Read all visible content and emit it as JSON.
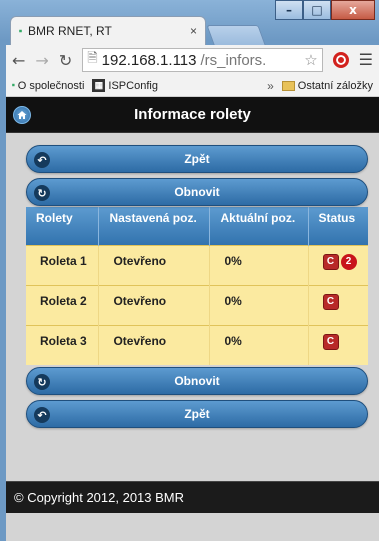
{
  "browser": {
    "tab_title": "BMR RNET, RT",
    "tab_close": "×",
    "url_host": "192.168.1.113",
    "url_path": "/rs_infors.",
    "window_controls": [
      "–",
      "□",
      "x"
    ],
    "bookmarks": [
      {
        "label": "O společnosti",
        "icon": "bmr-logo-icon"
      },
      {
        "label": "ISPConfig",
        "icon": "ispconfig-icon"
      }
    ],
    "bookmarks_more": "»",
    "other_bookmarks": "Ostatní záložky"
  },
  "header": {
    "title": "Informace rolety",
    "home_icon": "home-icon"
  },
  "buttons": {
    "back_label": "Zpět",
    "refresh_label": "Obnovit"
  },
  "table": {
    "columns": [
      "Rolety",
      "Nastavená poz.",
      "Aktuální poz.",
      "Status"
    ],
    "rows": [
      {
        "name": "Roleta 1",
        "set_pos": "Otevřeno",
        "actual_pos": "0%",
        "status": "C",
        "badge": "2"
      },
      {
        "name": "Roleta 2",
        "set_pos": "Otevřeno",
        "actual_pos": "0%",
        "status": "C",
        "badge": null
      },
      {
        "name": "Roleta 3",
        "set_pos": "Otevřeno",
        "actual_pos": "0%",
        "status": "C",
        "badge": null
      }
    ]
  },
  "footer": {
    "copyright": "© Copyright 2012, 2013 BMR"
  },
  "colors": {
    "button_blue": "#3273ae",
    "row_yellow": "#fbeaa0",
    "status_red": "#b82a28",
    "header_black": "#111111"
  }
}
